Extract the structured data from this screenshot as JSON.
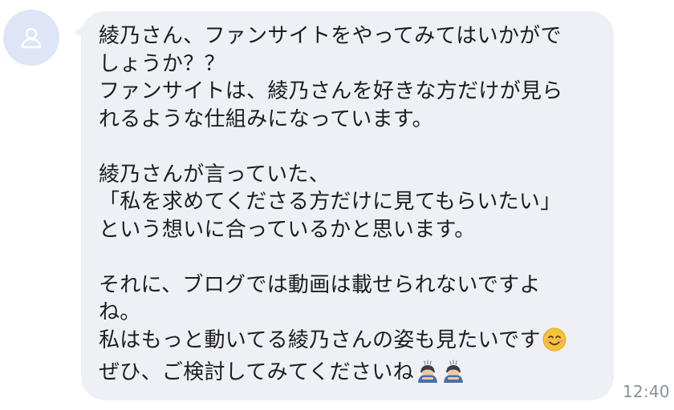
{
  "message": {
    "lines": [
      "綾乃さん、ファンサイトをやってみてはいかがで",
      "しょうか？？",
      "ファンサイトは、綾乃さんを好きな方だけが見ら",
      "れるような仕組みになっています。",
      "",
      "綾乃さんが言っていた、",
      "「私を求めてくださる方だけに見てもらいたい」",
      "という想いに合っているかと思います。",
      "",
      "それに、ブログでは動画は載せられないですよ",
      "ね。",
      "私はもっと動いてる綾乃さんの姿も見たいです",
      "ぜひ、ご検討してみてくださいね"
    ],
    "emoji": {
      "line12": "smiling-face-emoji",
      "line13": [
        "bowing-person-emoji",
        "bowing-person-emoji"
      ]
    }
  },
  "timestamp": "12:40",
  "colors": {
    "bubble": "#eef0f6",
    "avatar": "#dfe5f6",
    "avatar_icon": "#ffffff",
    "text": "#1d1d1f",
    "timestamp": "#8b8f99"
  }
}
